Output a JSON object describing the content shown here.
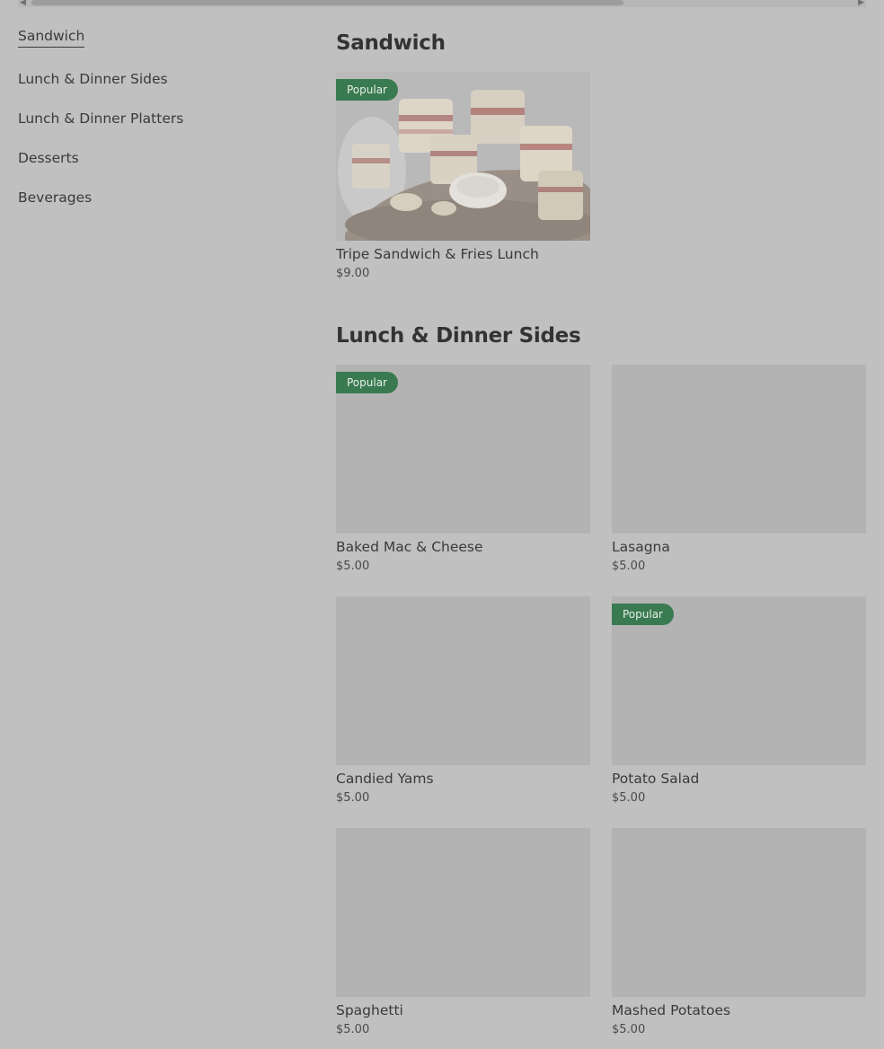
{
  "categories": [
    {
      "label": "Sandwich",
      "active": true
    },
    {
      "label": "Lunch & Dinner Sides"
    },
    {
      "label": "Lunch & Dinner Platters"
    },
    {
      "label": "Desserts"
    },
    {
      "label": "Beverages"
    }
  ],
  "sections": [
    {
      "title": "Sandwich",
      "items": [
        {
          "name": "Tripe Sandwich & Fries Lunch",
          "price": "$9.00",
          "badge": "Popular",
          "image": "sandwich-platter-photo"
        }
      ]
    },
    {
      "title": "Lunch & Dinner Sides",
      "items": [
        {
          "name": "Baked Mac & Cheese",
          "price": "$5.00",
          "badge": "Popular"
        },
        {
          "name": "Lasagna",
          "price": "$5.00"
        },
        {
          "name": "Candied Yams",
          "price": "$5.00"
        },
        {
          "name": "Potato Salad",
          "price": "$5.00",
          "badge": "Popular"
        },
        {
          "name": "Spaghetti",
          "price": "$5.00"
        },
        {
          "name": "Mashed Potatoes",
          "price": "$5.00"
        }
      ]
    }
  ],
  "colors": {
    "overlay_bg": "#c0c0c0",
    "badge": "#3a7a51",
    "placeholder": "#b3b3b3"
  },
  "icons": {
    "scroll_left": "chevron-left-icon",
    "scroll_right": "chevron-right-icon"
  }
}
